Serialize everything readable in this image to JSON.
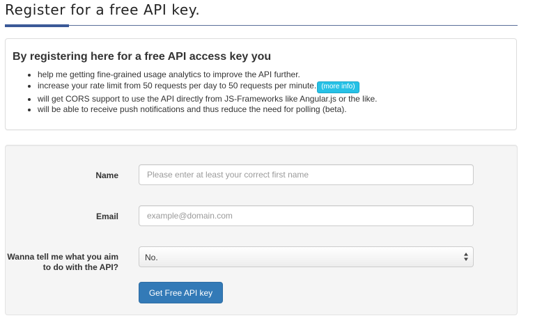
{
  "page": {
    "title": "Register for a free API key."
  },
  "info": {
    "heading": "By registering here for a free API access key you",
    "items": [
      "help me getting fine-grained usage analytics to improve the API further.",
      "increase your rate limit from 50 requests per day to 50 requests per minute.",
      "will get CORS support to use the API directly from JS-Frameworks like Angular.js or the like.",
      "will be able to receive push notifications and thus reduce the need for polling (beta)."
    ],
    "more_info_label": "(more info)"
  },
  "form": {
    "name_label": "Name",
    "name_placeholder": "Please enter at least your correct first name",
    "email_label": "Email",
    "email_placeholder": "example@domain.com",
    "aim_label": "Wanna tell me what you aim to do with the API?",
    "aim_selected": "No.",
    "submit_label": "Get Free API key"
  },
  "colors": {
    "title_accent": "#3b5998",
    "badge": "#27c1e6",
    "primary_button": "#337ab7"
  }
}
